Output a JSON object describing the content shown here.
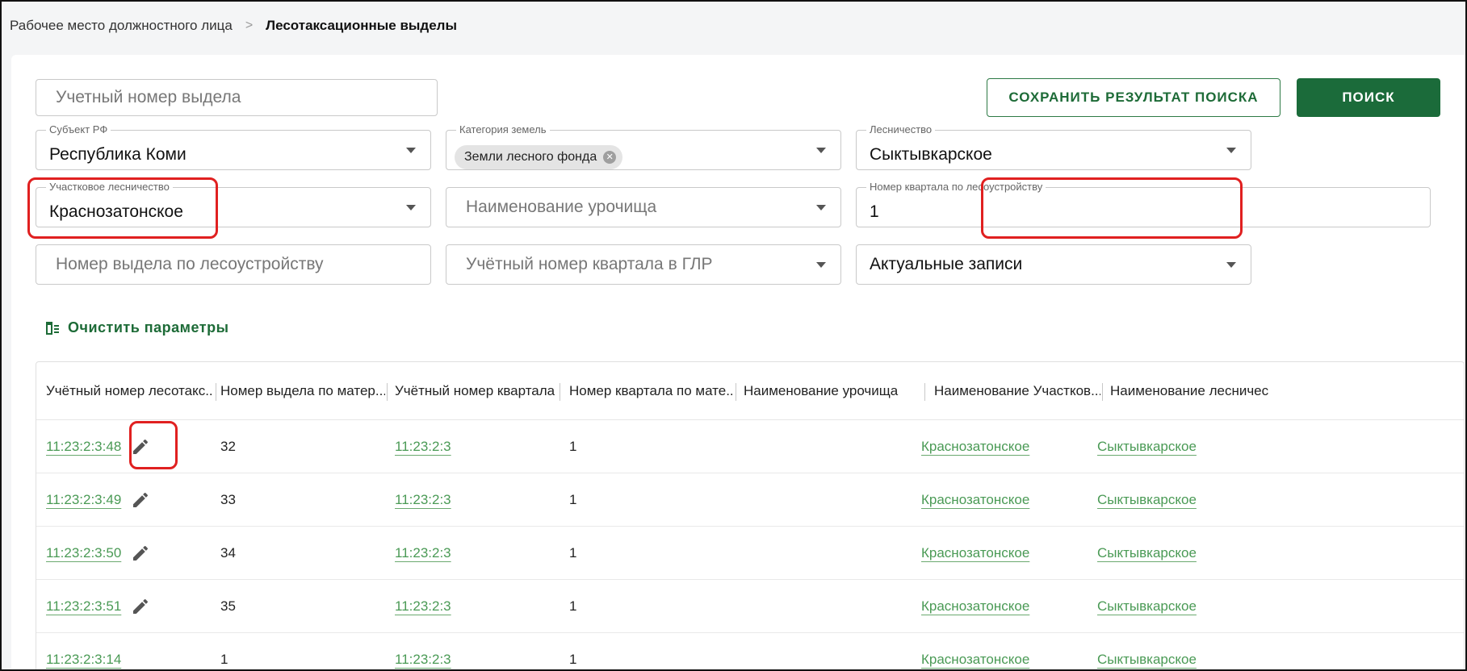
{
  "breadcrumb": {
    "parent": "Рабочее место должностного лица",
    "separator": ">",
    "current": "Лесотаксационные выделы"
  },
  "filters": {
    "account_number_placeholder": "Учетный номер выдела",
    "subject": {
      "label": "Субъект РФ",
      "value": "Республика Коми"
    },
    "land_category": {
      "label": "Категория земель",
      "chip": "Земли лесного фонда"
    },
    "forestry": {
      "label": "Лесничество",
      "value": "Сыктывкарское"
    },
    "district_forestry": {
      "label": "Участковое лесничество",
      "value": "Краснозатонское"
    },
    "tract_placeholder": "Наименование урочища",
    "quarter_number": {
      "label": "Номер квартала по лесоустройству",
      "value": "1"
    },
    "allotment_number_placeholder": "Номер выдела по лесоустройству",
    "quarter_glr_placeholder": "Учётный номер квартала в ГЛР",
    "records_value": "Актуальные записи"
  },
  "buttons": {
    "save_search": "СОХРАНИТЬ РЕЗУЛЬТАТ ПОИСКА",
    "search": "ПОИСК",
    "clear_params": "Очистить параметры"
  },
  "table": {
    "headers": [
      "Учётный номер лесотакс...",
      "Номер выдела по матер...",
      "Учётный номер квартала",
      "Номер квартала по мате...",
      "Наименование урочища",
      "Наименование Участков...",
      "Наименование лесничес"
    ],
    "rows": [
      {
        "id": "11:23:2:3:48",
        "allotment": "32",
        "quarter_id": "11:23:2:3",
        "quarter_no": "1",
        "tract": "",
        "district": "Краснозатонское",
        "forestry": "Сыктывкарское",
        "editable": true
      },
      {
        "id": "11:23:2:3:49",
        "allotment": "33",
        "quarter_id": "11:23:2:3",
        "quarter_no": "1",
        "tract": "",
        "district": "Краснозатонское",
        "forestry": "Сыктывкарское",
        "editable": true
      },
      {
        "id": "11:23:2:3:50",
        "allotment": "34",
        "quarter_id": "11:23:2:3",
        "quarter_no": "1",
        "tract": "",
        "district": "Краснозатонское",
        "forestry": "Сыктывкарское",
        "editable": true
      },
      {
        "id": "11:23:2:3:51",
        "allotment": "35",
        "quarter_id": "11:23:2:3",
        "quarter_no": "1",
        "tract": "",
        "district": "Краснозатонское",
        "forestry": "Сыктывкарское",
        "editable": true
      },
      {
        "id": "11:23:2:3:14",
        "allotment": "1",
        "quarter_id": "11:23:2:3",
        "quarter_no": "1",
        "tract": "",
        "district": "Краснозатонское",
        "forestry": "Сыктывкарское",
        "editable": false
      }
    ]
  },
  "colors": {
    "accent": "#1b6b3a",
    "link": "#4a9a55",
    "highlight": "#e02020"
  }
}
